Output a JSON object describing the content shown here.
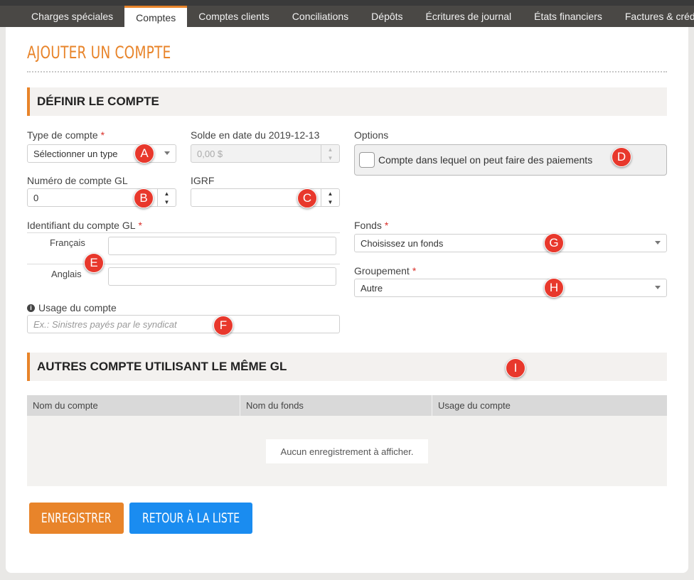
{
  "nav": {
    "tabs": [
      {
        "label": "Charges spéciales",
        "active": false
      },
      {
        "label": "Comptes",
        "active": true
      },
      {
        "label": "Comptes clients",
        "active": false
      },
      {
        "label": "Conciliations",
        "active": false
      },
      {
        "label": "Dépôts",
        "active": false
      },
      {
        "label": "Écritures de journal",
        "active": false
      },
      {
        "label": "États financiers",
        "active": false
      },
      {
        "label": "Factures & crédits",
        "active": false
      },
      {
        "label": "'",
        "active": false
      }
    ]
  },
  "page": {
    "title": "AJOUTER UN COMPTE"
  },
  "section1": {
    "title": "DÉFINIR LE COMPTE"
  },
  "form": {
    "type_label": "Type de compte",
    "type_value": "Sélectionner un type",
    "solde_label": "Solde en date du 2019-12-13",
    "solde_placeholder": "0,00 $",
    "options_label": "Options",
    "options_checkbox_label": "Compte dans lequel on peut faire des paiements",
    "gl_label": "Numéro de compte GL",
    "gl_value": "0",
    "igrf_label": "IGRF",
    "igrf_value": "",
    "identifiant_label": "Identifiant du compte GL",
    "francais_label": "Français",
    "anglais_label": "Anglais",
    "francais_value": "",
    "anglais_value": "",
    "fonds_label": "Fonds",
    "fonds_value": "Choisissez un fonds",
    "groupement_label": "Groupement",
    "groupement_value": "Autre",
    "usage_label": "Usage du compte",
    "usage_placeholder": "Ex.: Sinistres payés par le syndicat",
    "required_mark": "*"
  },
  "badges": [
    "A",
    "B",
    "C",
    "D",
    "E",
    "F",
    "G",
    "H",
    "I"
  ],
  "section2": {
    "title": "AUTRES COMPTE UTILISANT LE MÊME GL"
  },
  "table": {
    "columns": [
      "Nom du compte",
      "Nom du fonds",
      "Usage du compte"
    ],
    "empty_message": "Aucun enregistrement à afficher."
  },
  "buttons": {
    "save": "ENREGISTRER",
    "back": "RETOUR À LA LISTE"
  },
  "colors": {
    "accent": "#e8842a",
    "primary": "#1a8cf0",
    "badge": "#e8382c",
    "nav_bg": "#4a4845"
  }
}
